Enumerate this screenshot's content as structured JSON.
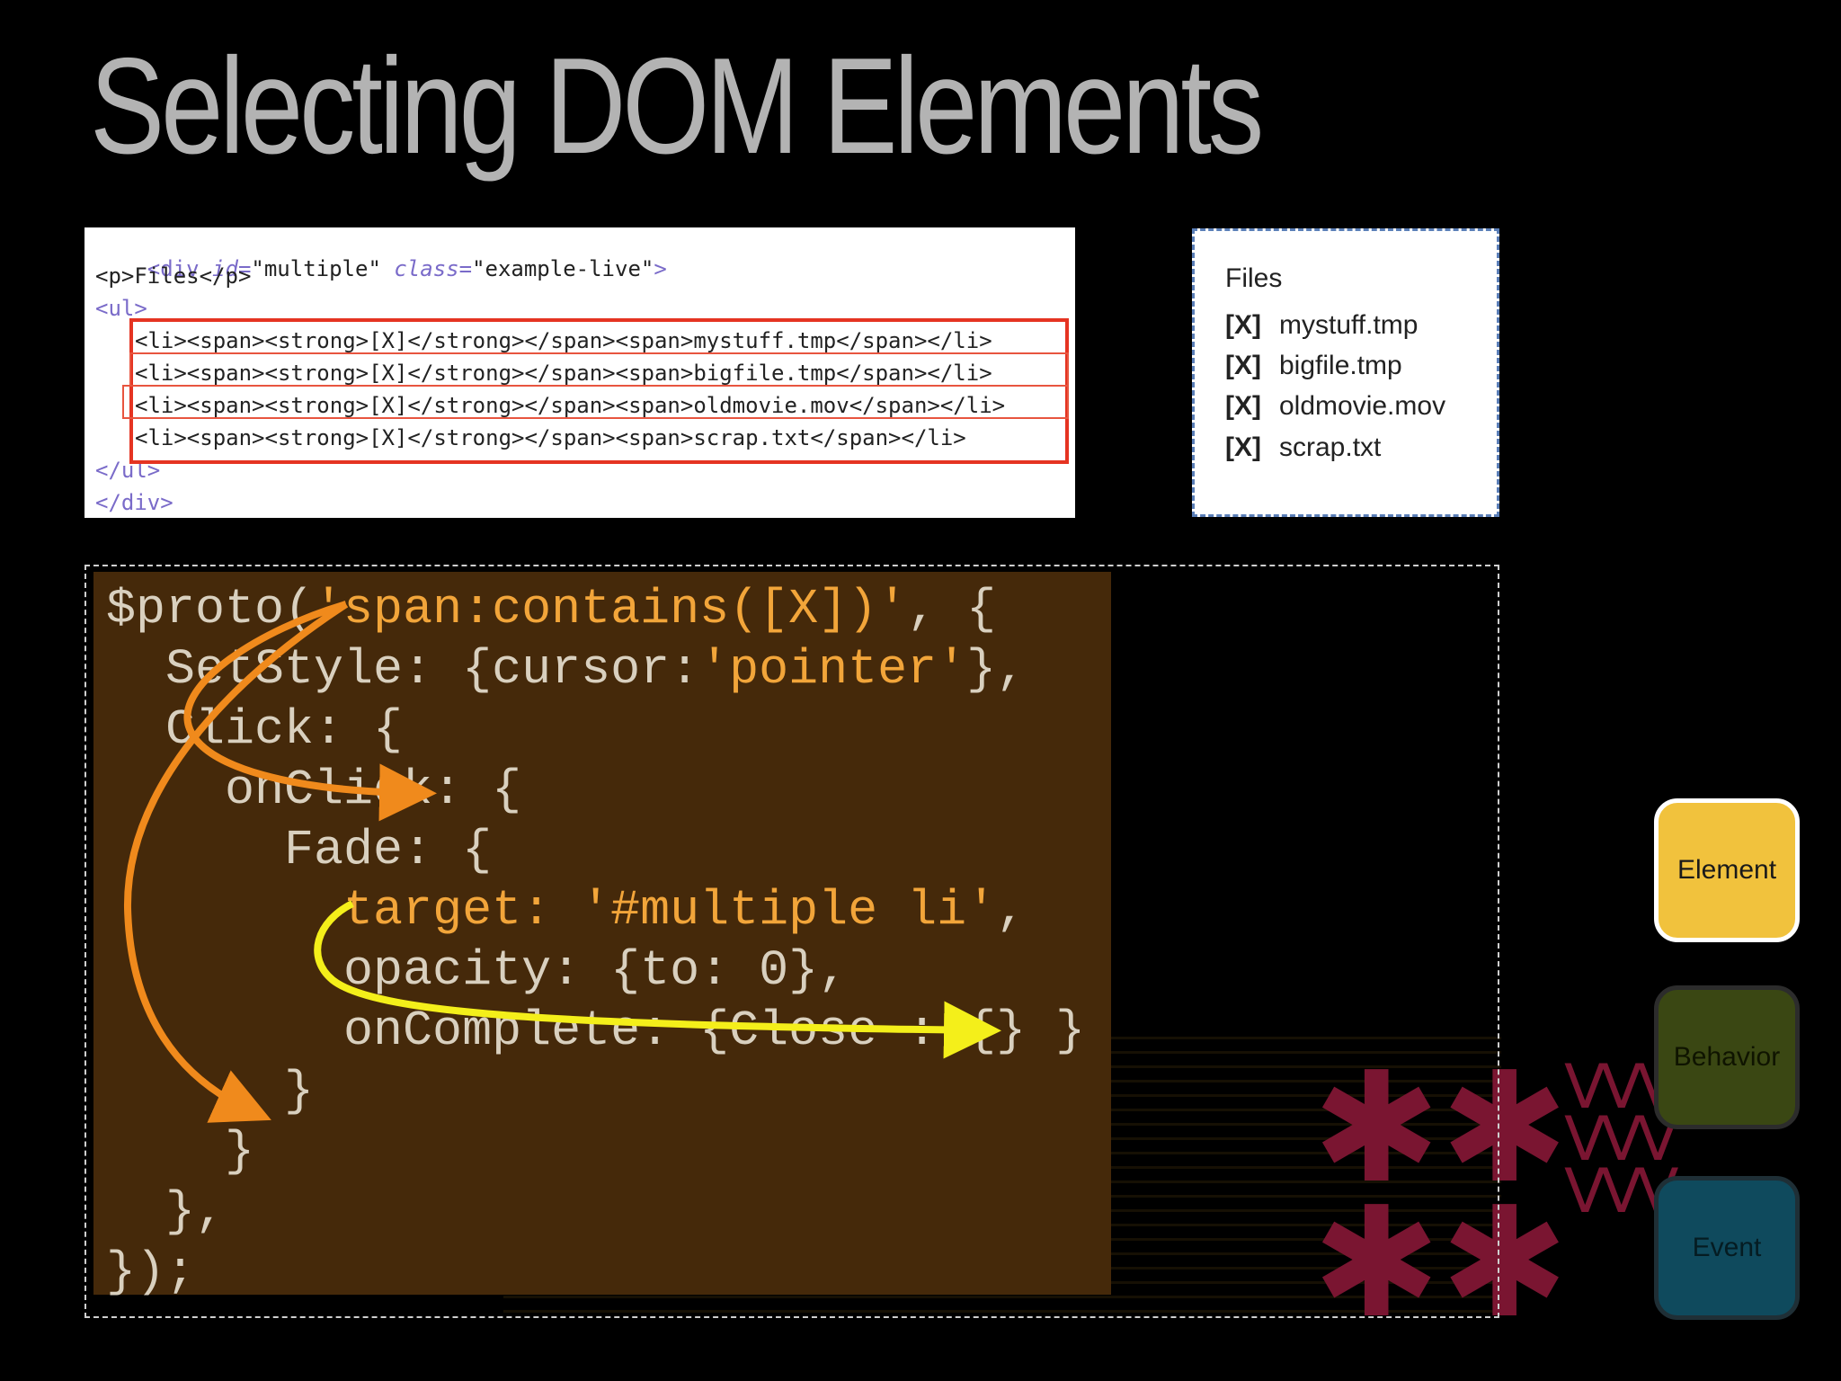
{
  "slide": {
    "title": "Selecting DOM Elements"
  },
  "source_code": {
    "line1_tag_open": "<div ",
    "line1_id_attr": "id=",
    "line1_id_val": "\"multiple\" ",
    "line1_class_attr": "class=",
    "line1_class_val": "\"example-live\"",
    "line1_close": ">",
    "line2": "<p>Files</p>",
    "line3": "<ul>",
    "list_items": [
      "<li><span><strong>[X]</strong></span><span>mystuff.tmp</span></li>",
      "<li><span><strong>[X]</strong></span><span>bigfile.tmp</span></li>",
      "<li><span><strong>[X]</strong></span><span>oldmovie.mov</span></li>",
      "<li><span><strong>[X]</strong></span><span>scrap.txt</span></li>"
    ],
    "line_ul_close": "</ul>",
    "line_div_close": "</div>"
  },
  "rendered": {
    "heading": "Files",
    "marker": "[X]",
    "files": [
      "mystuff.tmp",
      "bigfile.tmp",
      "oldmovie.mov",
      "scrap.txt"
    ]
  },
  "code": {
    "lines": [
      {
        "plain": "$proto(",
        "str": "'span:contains([X])'",
        "rest": ", {"
      },
      {
        "plain": "  SetStyle: {cursor:",
        "str": "'pointer'",
        "rest": "},"
      },
      {
        "plain": "  Click: {",
        "str": "",
        "rest": ""
      },
      {
        "plain": "    onClick: {",
        "str": "",
        "rest": ""
      },
      {
        "plain": "      Fade: {",
        "str": "",
        "rest": ""
      },
      {
        "plain": "        ",
        "str": "target: '#multiple li'",
        "rest": ","
      },
      {
        "plain": "        opacity: {to: 0},",
        "str": "",
        "rest": ""
      },
      {
        "plain": "        onComplete: {Close : {} }",
        "str": "",
        "rest": ""
      },
      {
        "plain": "      }",
        "str": "",
        "rest": ""
      },
      {
        "plain": "    }",
        "str": "",
        "rest": ""
      },
      {
        "plain": "  },",
        "str": "",
        "rest": ""
      },
      {
        "plain": "});",
        "str": "",
        "rest": ""
      }
    ]
  },
  "legend": {
    "element": "Element",
    "behavior": "Behavior",
    "event": "Event"
  },
  "colors": {
    "orange_arrow": "#f08a1c",
    "yellow_arrow": "#f4ef1a",
    "element": "#f1c23d",
    "behavior": "#3a4713",
    "event": "#0f4a5d"
  }
}
